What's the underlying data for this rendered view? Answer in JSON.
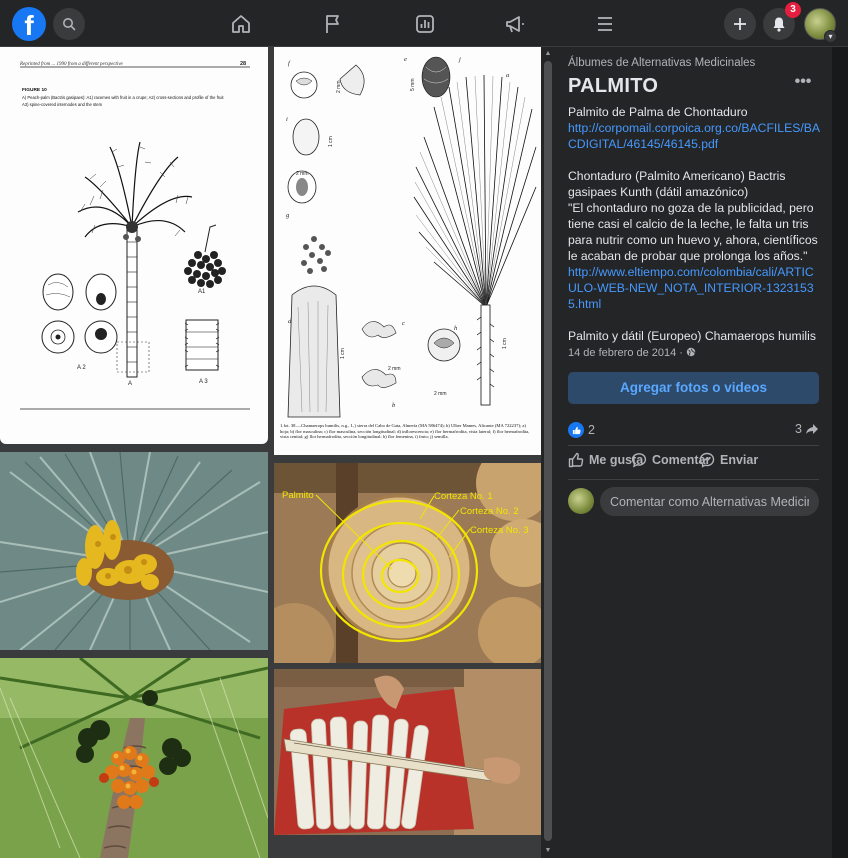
{
  "topbar": {
    "logo_letter": "f",
    "notifications_count": "3"
  },
  "album": {
    "name": "Álbumes de Alternativas Medicinales",
    "title": "PALMITO",
    "more": "•••"
  },
  "description": {
    "p1_text": "Palmito de Palma de Chontaduro",
    "p1_link": "http://corpomail.corpoica.org.co/BACFILES/BACDIGITAL/46145/46145.pdf",
    "p2_title": "Chontaduro (Palmito Americano) Bactris gasipaes Kunth (dátil amazónico)",
    "p2_quote": "\"El chontaduro no goza de la publicidad, pero tiene casi el calcio de la leche, le falta un tris para nutrir como un huevo y, ahora, científicos le acaban de probar que prolonga los años.\"",
    "p2_link": "http://www.eltiempo.com/colombia/cali/ARTICULO-WEB-NEW_NOTA_INTERIOR-13231535.html",
    "p3_text": "Palmito y dátil (Europeo) Chamaerops humilis"
  },
  "date": "14 de febrero de 2014 ·",
  "add_photos_label": "Agregar fotos o videos",
  "reactions": {
    "likes": "2",
    "shares": "3"
  },
  "actions": {
    "like": "Me gusta",
    "comment": "Comentar",
    "share": "Enviar"
  },
  "comment_box": {
    "placeholder": "Comentar como Alternativas Medicinales"
  },
  "photos": {
    "p1": {
      "header": "Reprinted from ... 1990 from a different perspective",
      "page": "28",
      "figure": "FIGURE 10",
      "caption_a": "A) Peach-palm (Bactris gasipaes): A1) racemes with fruit in a crupe; A2) cross-sections and profile of the fruit",
      "caption_b": "A3) spine-covered internodes and the stem",
      "label_a1": "A1",
      "label_a2": "A 2",
      "label_a": "A",
      "label_a3": "A 3"
    },
    "p2": {
      "caption": "1.fot. 38.—Chamaerops humilis, n.g., I.,) sierra del Cabo de Gata, Almería (MA 586474); b) Ulber Mames, Alicante (MA 722237); a) hoja; b) flor masculina; c) flor masculina, sección longitudinal; d) inflorescencia; e) flor hermafrodita, vista lateral; f) flor hermafrodita, vista cenital; g) flor hermafrodita, sección longitudinal; h) flor femenina, i) fruto; j) semilla.",
      "labels": [
        "f",
        "e",
        "j",
        "a",
        "i",
        "g",
        "d",
        "c",
        "h",
        "b"
      ],
      "scales": [
        "2 mm",
        "5 mm",
        "1 cm",
        "2 mm",
        "1 cm",
        "2 mm",
        "1 cm",
        "2 mm"
      ]
    },
    "p4": {
      "labels": [
        "Palmito",
        "Corteza No. 1",
        "Corteza No. 2",
        "Corteza No. 3"
      ]
    }
  }
}
